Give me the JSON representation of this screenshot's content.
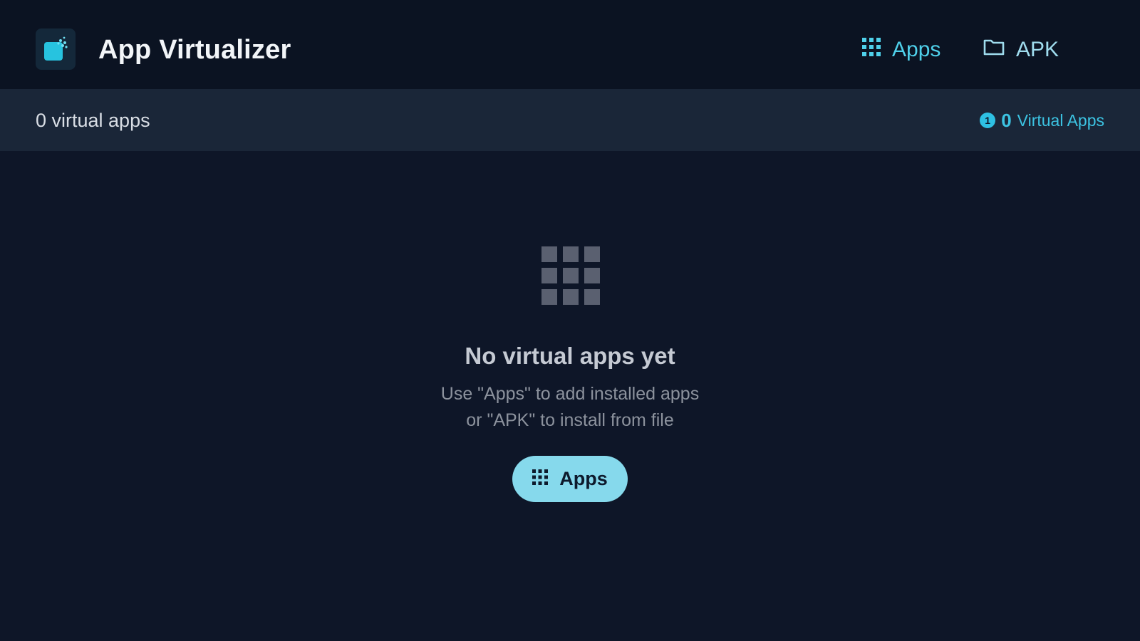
{
  "header": {
    "app_title": "App Virtualizer",
    "logo_icon": "app-virtualizer-logo",
    "nav": [
      {
        "label": "Apps",
        "icon": "grid-icon",
        "color": "#4fd0ea",
        "active": true
      },
      {
        "label": "APK",
        "icon": "folder-icon",
        "color": "#9fdcee",
        "active": false
      }
    ]
  },
  "subbar": {
    "count_label": "0 virtual apps",
    "badge": {
      "icon": "info-icon",
      "icon_glyph": "1",
      "count": "0",
      "label": "Virtual Apps"
    }
  },
  "empty_state": {
    "icon": "grid-icon",
    "title": "No virtual apps yet",
    "description_line1": "Use \"Apps\" to add installed apps",
    "description_line2": "or \"APK\" to install from file",
    "button_label": "Apps",
    "button_icon": "grid-icon"
  },
  "colors": {
    "background": "#0e1628",
    "header_bg": "#0b1322",
    "subbar_bg": "#1a2638",
    "accent": "#4fd0ea",
    "button_bg": "#86d9ec"
  }
}
